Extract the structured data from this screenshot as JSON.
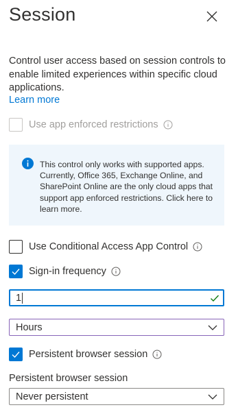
{
  "header": {
    "title": "Session",
    "close_icon": "close-icon"
  },
  "description": "Control user access based on session controls to enable limited experiences within specific cloud applications.",
  "learn_more": "Learn more",
  "app_enforced": {
    "label": "Use app enforced restrictions",
    "checked": false,
    "disabled": true
  },
  "info_box": {
    "icon": "info-icon",
    "text": "This control only works with supported apps. Currently, Office 365, Exchange Online, and SharePoint Online are the only cloud apps that support app enforced restrictions. Click here to learn more."
  },
  "conditional_access": {
    "label": "Use Conditional Access App Control",
    "checked": false
  },
  "sign_in_frequency": {
    "label": "Sign-in frequency",
    "checked": true,
    "value": "1",
    "unit": "Hours"
  },
  "persistent_session": {
    "label": "Persistent browser session",
    "checked": true,
    "field_label": "Persistent browser session",
    "value": "Never persistent"
  },
  "colors": {
    "accent": "#0078d4",
    "info_bg": "#eff6fc",
    "valid": "#107c10",
    "focus_purple": "#8764b8"
  }
}
